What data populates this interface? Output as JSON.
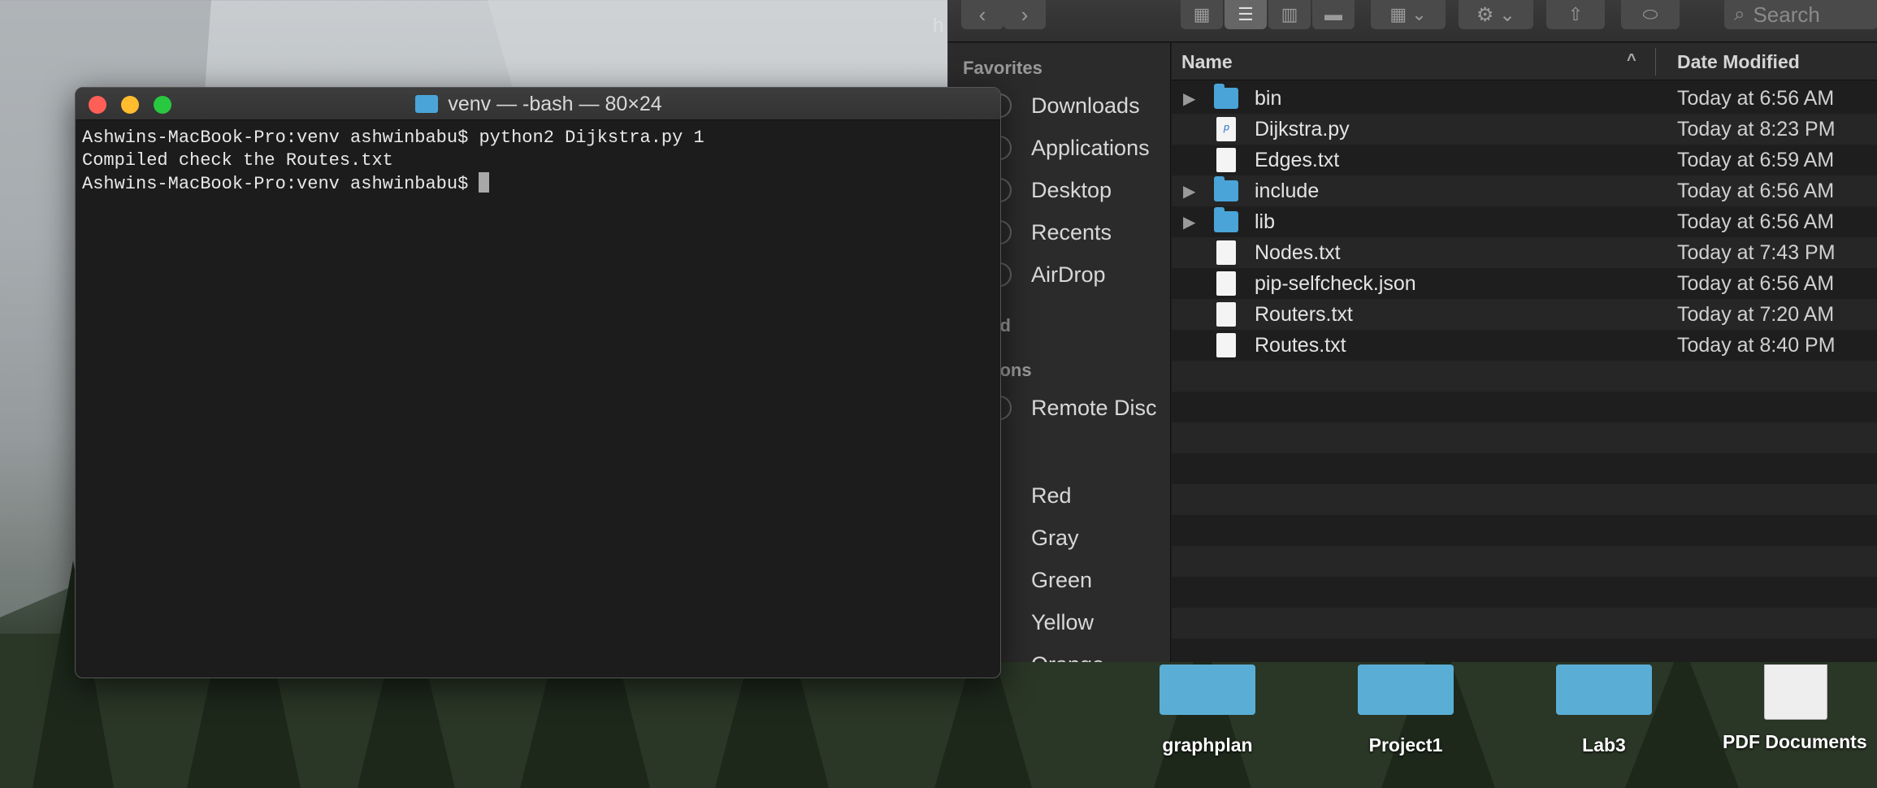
{
  "terminal": {
    "title": "venv — -bash — 80×24",
    "lines": [
      "Ashwins-MacBook-Pro:venv ashwinbabu$ python2 Dijkstra.py 1",
      "Compiled check the Routes.txt",
      "Ashwins-MacBook-Pro:venv ashwinbabu$ "
    ]
  },
  "finder": {
    "search_placeholder": "Search",
    "sidebar": {
      "favorites_header": "Favorites",
      "favorites": [
        "Downloads",
        "Applications",
        "Desktop",
        "Recents",
        "AirDrop"
      ],
      "icloud_header_partial": "ud",
      "locations_header_partial": "tions",
      "locations": [
        "Remote Disc"
      ],
      "tags": [
        "Red",
        "Gray",
        "Green",
        "Yellow",
        "Orange"
      ]
    },
    "columns": {
      "name": "Name",
      "date": "Date Modified",
      "sort_glyph": "^"
    },
    "rows": [
      {
        "name": "bin",
        "date": "Today at 6:56 AM",
        "kind": "folder"
      },
      {
        "name": "Dijkstra.py",
        "date": "Today at 8:23 PM",
        "kind": "python"
      },
      {
        "name": "Edges.txt",
        "date": "Today at 6:59 AM",
        "kind": "doc"
      },
      {
        "name": "include",
        "date": "Today at 6:56 AM",
        "kind": "folder"
      },
      {
        "name": "lib",
        "date": "Today at 6:56 AM",
        "kind": "folder"
      },
      {
        "name": "Nodes.txt",
        "date": "Today at 7:43 PM",
        "kind": "doc"
      },
      {
        "name": "pip-selfcheck.json",
        "date": "Today at 6:56 AM",
        "kind": "doc"
      },
      {
        "name": "Routers.txt",
        "date": "Today at 7:20 AM",
        "kind": "doc"
      },
      {
        "name": "Routes.txt",
        "date": "Today at 8:40 PM",
        "kind": "doc"
      }
    ]
  },
  "desktop": {
    "fragment": "h",
    "icons": [
      {
        "label": "graphplan",
        "kind": "folder"
      },
      {
        "label": "Project1",
        "kind": "folder"
      },
      {
        "label": "Lab3",
        "kind": "folder"
      },
      {
        "label": "PDF Documents",
        "kind": "pdf"
      }
    ]
  },
  "colors": {
    "folder": "#4aa4d8",
    "close": "#fe5f57",
    "minimize": "#febc2e",
    "maximize": "#28c840"
  }
}
